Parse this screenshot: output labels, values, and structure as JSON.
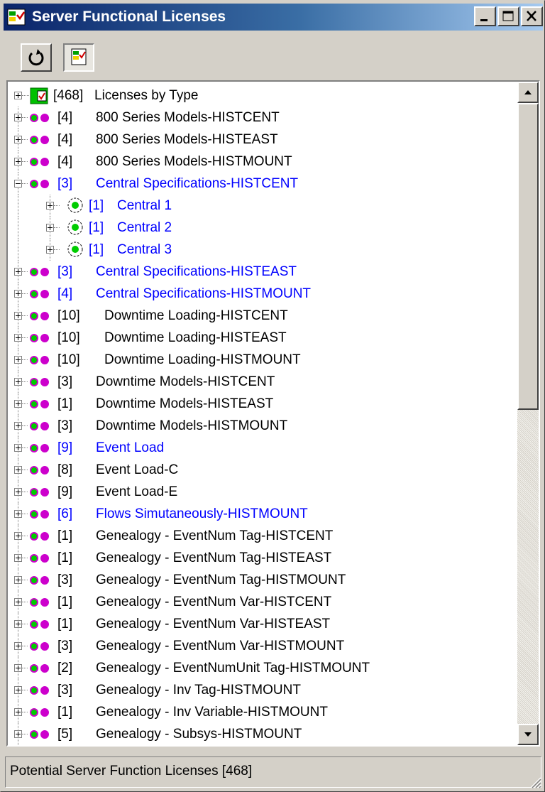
{
  "window": {
    "title": "Server Functional Licenses"
  },
  "toolbar": {
    "refresh_icon": "refresh-icon",
    "license_view_icon": "license-tree-icon"
  },
  "tree": {
    "root": {
      "count": "[468]",
      "label": "Licenses by Type"
    },
    "items": [
      {
        "count": "[4]",
        "label": "800 Series Models-HISTCENT",
        "color": "black"
      },
      {
        "count": "[4]",
        "label": "800 Series Models-HISTEAST",
        "color": "black"
      },
      {
        "count": "[4]",
        "label": "800 Series Models-HISTMOUNT",
        "color": "black"
      },
      {
        "count": "[3]",
        "label": "Central Specifications-HISTCENT",
        "color": "blue",
        "expanded": true
      },
      {
        "count": "[1]",
        "label": "Central 1",
        "color": "blue",
        "child": true
      },
      {
        "count": "[1]",
        "label": "Central 2",
        "color": "blue",
        "child": true
      },
      {
        "count": "[1]",
        "label": "Central 3",
        "color": "blue",
        "child": true
      },
      {
        "count": "[3]",
        "label": "Central Specifications-HISTEAST",
        "color": "blue"
      },
      {
        "count": "[4]",
        "label": "Central Specifications-HISTMOUNT",
        "color": "blue"
      },
      {
        "count": "[10]",
        "label": "Downtime Loading-HISTCENT",
        "color": "black"
      },
      {
        "count": "[10]",
        "label": "Downtime Loading-HISTEAST",
        "color": "black"
      },
      {
        "count": "[10]",
        "label": "Downtime Loading-HISTMOUNT",
        "color": "black"
      },
      {
        "count": "[3]",
        "label": "Downtime Models-HISTCENT",
        "color": "black"
      },
      {
        "count": "[1]",
        "label": "Downtime Models-HISTEAST",
        "color": "black"
      },
      {
        "count": "[3]",
        "label": "Downtime Models-HISTMOUNT",
        "color": "black"
      },
      {
        "count": "[9]",
        "label": "Event Load",
        "color": "blue"
      },
      {
        "count": "[8]",
        "label": "Event Load-C",
        "color": "black"
      },
      {
        "count": "[9]",
        "label": "Event Load-E",
        "color": "black"
      },
      {
        "count": "[6]",
        "label": "Flows Simutaneously-HISTMOUNT",
        "color": "blue"
      },
      {
        "count": "[1]",
        "label": "Genealogy - EventNum Tag-HISTCENT",
        "color": "black"
      },
      {
        "count": "[1]",
        "label": "Genealogy - EventNum Tag-HISTEAST",
        "color": "black"
      },
      {
        "count": "[3]",
        "label": "Genealogy - EventNum Tag-HISTMOUNT",
        "color": "black"
      },
      {
        "count": "[1]",
        "label": "Genealogy - EventNum Var-HISTCENT",
        "color": "black"
      },
      {
        "count": "[1]",
        "label": "Genealogy - EventNum Var-HISTEAST",
        "color": "black"
      },
      {
        "count": "[3]",
        "label": "Genealogy - EventNum Var-HISTMOUNT",
        "color": "black"
      },
      {
        "count": "[2]",
        "label": "Genealogy - EventNumUnit Tag-HISTMOUNT",
        "color": "black"
      },
      {
        "count": "[3]",
        "label": "Genealogy - Inv Tag-HISTMOUNT",
        "color": "black"
      },
      {
        "count": "[1]",
        "label": "Genealogy - Inv Variable-HISTMOUNT",
        "color": "black"
      },
      {
        "count": "[5]",
        "label": "Genealogy - Subsys-HISTMOUNT",
        "color": "black"
      }
    ]
  },
  "status": {
    "text": "Potential Server Function Licenses [468]"
  },
  "colors": {
    "title_gradient_start": "#0a246a",
    "title_gradient_end": "#a6caf0",
    "blue_text": "#0000ff",
    "dot_magenta": "#cc00cc",
    "dot_green": "#00cc00"
  }
}
